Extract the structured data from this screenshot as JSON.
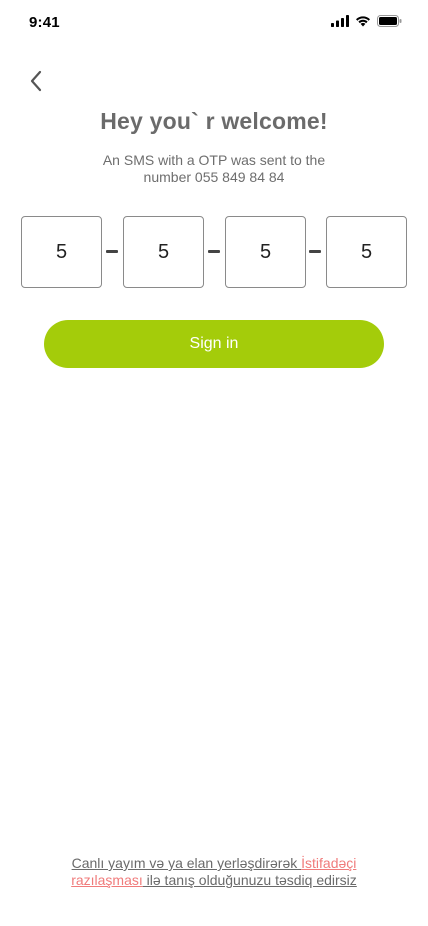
{
  "status_bar": {
    "time": "9:41"
  },
  "header": {
    "title": "Hey you` r welcome!",
    "subtitle": "An SMS with a OTP was sent to the number 055 849 84 84"
  },
  "otp": {
    "digits": [
      "5",
      "5",
      "5",
      "5"
    ]
  },
  "actions": {
    "signin_label": "Sign in"
  },
  "footer": {
    "terms_prefix": "Canlı yayım və ya elan yerləşdirərək ",
    "terms_link": "İstifadəçi razılaşması",
    "terms_suffix": " ilə tanış olduğunuzu təsdiq edirsiz"
  },
  "colors": {
    "accent": "#a4cc0a",
    "link": "#f07b7b"
  },
  "icons": [
    "signal-icon",
    "wifi-icon",
    "battery-icon",
    "back-arrow-icon"
  ]
}
